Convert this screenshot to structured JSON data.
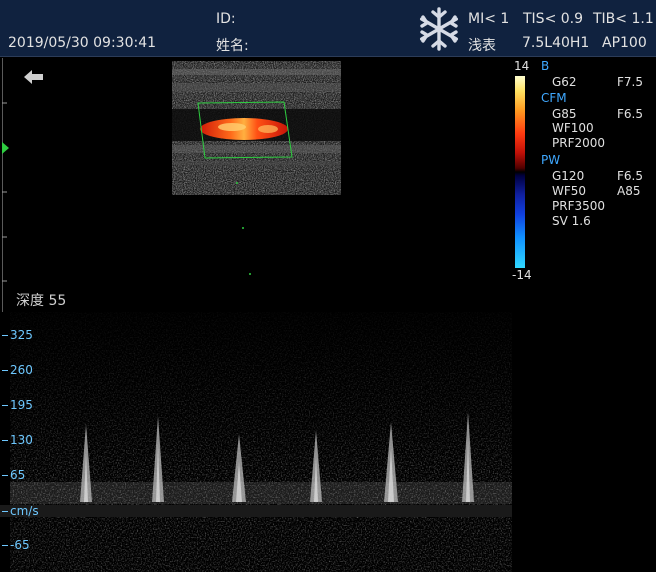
{
  "header": {
    "datetime": "2019/05/30 09:30:41",
    "id_label": "ID:",
    "name_label": "姓名:",
    "mi": "MI< 1",
    "tis": "TIS< 0.9",
    "tib": "TIB< 1.1",
    "exam": "浅表",
    "probe": "7.5L40H1",
    "ap": "AP100",
    "freeze_icon": "snowflake-icon"
  },
  "image": {
    "depth_label": "深度",
    "depth_value": "55",
    "back_icon": "back-arrow-icon",
    "focus_icon": "focus-marker-icon"
  },
  "colorbar": {
    "top": "14",
    "bottom": "-14"
  },
  "params": {
    "b_head": "B",
    "b_gain": "G62",
    "b_freq": "F7.5",
    "cfm_head": "CFM",
    "cfm_gain": "G85",
    "cfm_freq": "F6.5",
    "cfm_wf": "WF100",
    "cfm_prf": "PRF2000",
    "pw_head": "PW",
    "pw_gain": "G120",
    "pw_freq": "F6.5",
    "pw_wf": "WF50",
    "pw_angle": "A85",
    "pw_prf": "PRF3500",
    "pw_sv": "SV 1.6"
  },
  "spectrum": {
    "scale": [
      {
        "label": "325"
      },
      {
        "label": "260"
      },
      {
        "label": "195"
      },
      {
        "label": "130"
      },
      {
        "label": "65"
      },
      {
        "label": "cm/s"
      },
      {
        "label": "-65"
      }
    ]
  },
  "colors": {
    "header_bg": "#10223f",
    "scale_color": "#6ec8ff",
    "param_head": "#3fa8ff",
    "roi_box": "#2ecc40"
  }
}
